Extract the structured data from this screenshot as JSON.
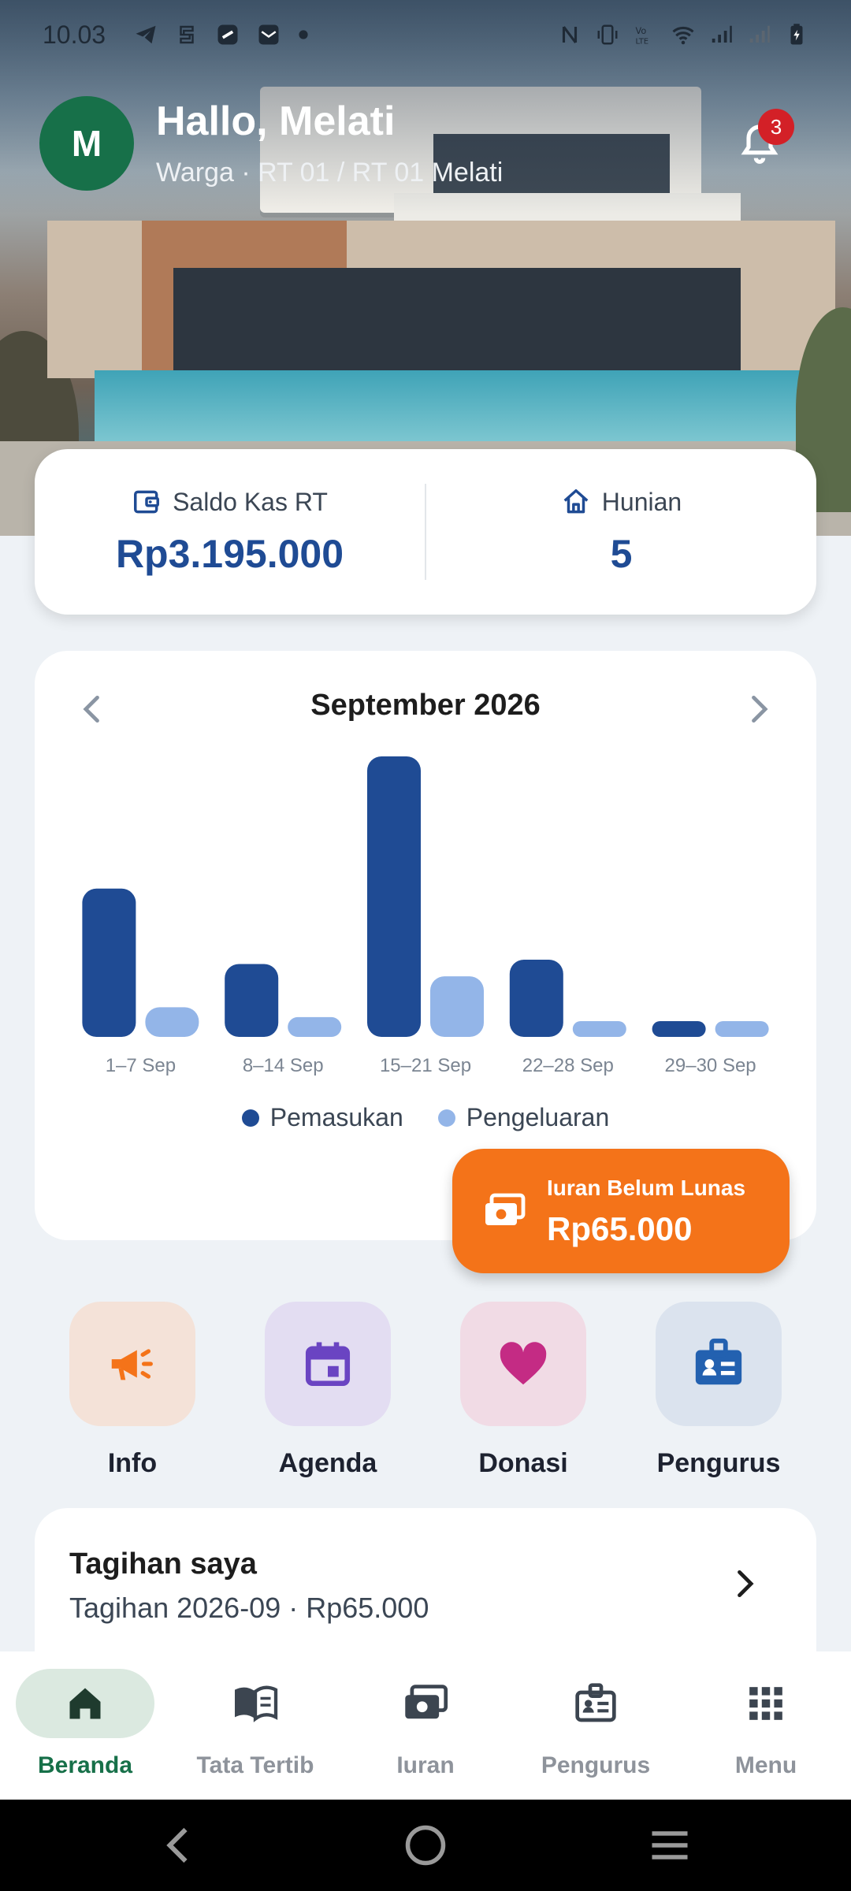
{
  "status_bar": {
    "time": "10.03",
    "notification_icons": [
      "telegram-icon",
      "stack-icon",
      "app-icon",
      "mail-icon",
      "dot-icon"
    ],
    "system_icons": [
      "nfc-icon",
      "vibrate-icon",
      "volte-icon",
      "wifi-icon",
      "signal-icon",
      "signal-icon",
      "battery-icon"
    ]
  },
  "header": {
    "avatar_initial": "M",
    "greeting": "Hallo, Melati",
    "subtitle": "Warga · RT 01 / RT 01 Melati",
    "notification_count": "3"
  },
  "summary": {
    "saldo_label": "Saldo Kas RT",
    "saldo_value": "Rp3.195.000",
    "hunian_label": "Hunian",
    "hunian_value": "5"
  },
  "chart_data": {
    "type": "bar",
    "title": "September 2026",
    "categories": [
      "1–7 Sep",
      "8–14 Sep",
      "15–21 Sep",
      "22–28 Sep",
      "29–30 Sep"
    ],
    "series": [
      {
        "name": "Pemasukan",
        "color": "#1f4b94",
        "values": [
          1200000,
          590000,
          2270000,
          625000,
          120000
        ]
      },
      {
        "name": "Pengeluaran",
        "color": "#93b5e8",
        "values": [
          240000,
          160000,
          490000,
          120000,
          120000
        ]
      }
    ],
    "legend": "bottom",
    "grid": false
  },
  "iuran_alert": {
    "title": "Iuran Belum Lunas",
    "amount": "Rp65.000",
    "icon": "money-icon"
  },
  "quick_actions": [
    {
      "label": "Info",
      "icon": "megaphone-icon",
      "bg": "#f4e2d8",
      "fg": "#f47319"
    },
    {
      "label": "Agenda",
      "icon": "calendar-icon",
      "bg": "#e3ddf2",
      "fg": "#6a44c2"
    },
    {
      "label": "Donasi",
      "icon": "heart-icon",
      "bg": "#f1dbe5",
      "fg": "#c42b84"
    },
    {
      "label": "Pengurus",
      "icon": "badge-icon",
      "bg": "#dbe3ee",
      "fg": "#2361b0"
    }
  ],
  "tagihan": {
    "title": "Tagihan saya",
    "detail": "Tagihan 2026-09 · Rp65.000"
  },
  "bottom_nav": [
    {
      "label": "Beranda",
      "icon": "home-icon",
      "active": true
    },
    {
      "label": "Tata Tertib",
      "icon": "book-icon",
      "active": false
    },
    {
      "label": "Iuran",
      "icon": "money-icon",
      "active": false
    },
    {
      "label": "Pengurus",
      "icon": "badge-icon",
      "active": false
    },
    {
      "label": "Menu",
      "icon": "grid-icon",
      "active": false
    }
  ],
  "colors": {
    "primary_green": "#177049",
    "primary_blue": "#1f4b94",
    "accent_orange": "#f47319"
  }
}
